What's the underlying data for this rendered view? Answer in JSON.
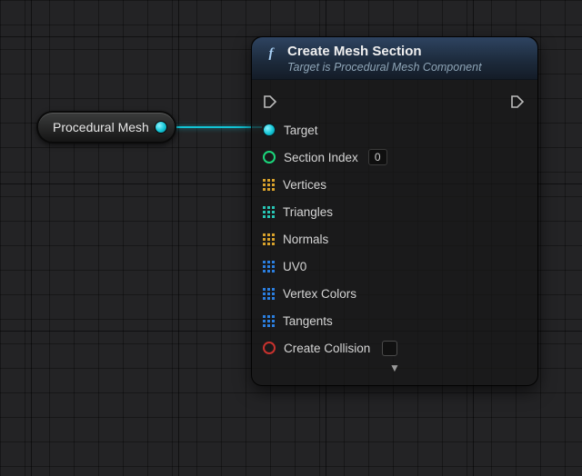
{
  "source_node": {
    "label": "Procedural Mesh"
  },
  "node": {
    "title": "Create Mesh Section",
    "subtitle": "Target is Procedural Mesh Component",
    "pins": {
      "target": {
        "label": "Target"
      },
      "section_index": {
        "label": "Section Index",
        "value": "0"
      },
      "vertices": {
        "label": "Vertices"
      },
      "triangles": {
        "label": "Triangles"
      },
      "normals": {
        "label": "Normals"
      },
      "uv0": {
        "label": "UV0"
      },
      "vertex_colors": {
        "label": "Vertex Colors"
      },
      "tangents": {
        "label": "Tangents"
      },
      "create_collision": {
        "label": "Create Collision",
        "checked": false
      }
    }
  }
}
